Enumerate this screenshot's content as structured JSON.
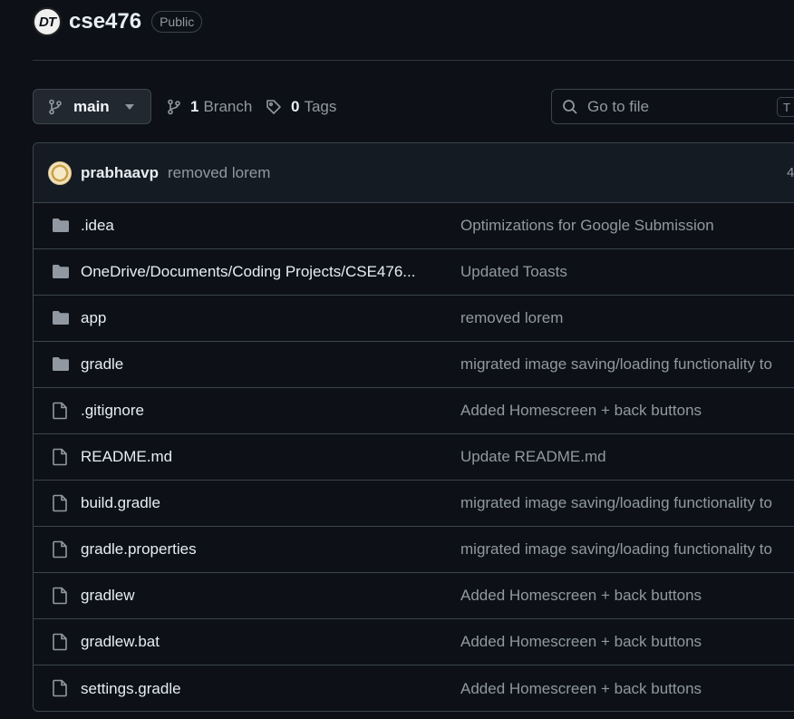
{
  "repo": {
    "owner_logo_text": "DT",
    "name": "cse476",
    "visibility": "Public"
  },
  "toolbar": {
    "branch": "main",
    "branch_count": "1",
    "branch_label": "Branch",
    "tag_count": "0",
    "tag_label": "Tags",
    "goto_placeholder": "Go to file",
    "goto_shortcut": "T"
  },
  "latest_commit": {
    "author": "prabhaavp",
    "message": "removed lorem",
    "time": "4"
  },
  "files": [
    {
      "type": "folder",
      "name": ".idea",
      "commit": "Optimizations for Google Submission"
    },
    {
      "type": "folder",
      "name": "OneDrive/Documents/Coding Projects/CSE476...",
      "commit": "Updated Toasts"
    },
    {
      "type": "folder",
      "name": "app",
      "commit": "removed lorem"
    },
    {
      "type": "folder",
      "name": "gradle",
      "commit": "migrated image saving/loading functionality to"
    },
    {
      "type": "file",
      "name": ".gitignore",
      "commit": "Added Homescreen + back buttons"
    },
    {
      "type": "file",
      "name": "README.md",
      "commit": "Update README.md"
    },
    {
      "type": "file",
      "name": "build.gradle",
      "commit": "migrated image saving/loading functionality to"
    },
    {
      "type": "file",
      "name": "gradle.properties",
      "commit": "migrated image saving/loading functionality to"
    },
    {
      "type": "file",
      "name": "gradlew",
      "commit": "Added Homescreen + back buttons"
    },
    {
      "type": "file",
      "name": "gradlew.bat",
      "commit": "Added Homescreen + back buttons"
    },
    {
      "type": "file",
      "name": "settings.gradle",
      "commit": "Added Homescreen + back buttons"
    }
  ],
  "colors": {
    "background": "#0d1117",
    "border": "#3d444d",
    "muted_text": "#9198a1",
    "folder_icon": "#9198a1"
  },
  "icons": {
    "folder": "folder-icon",
    "file": "file-icon",
    "branch": "git-branch-icon",
    "tag": "tag-icon",
    "search": "search-icon"
  }
}
